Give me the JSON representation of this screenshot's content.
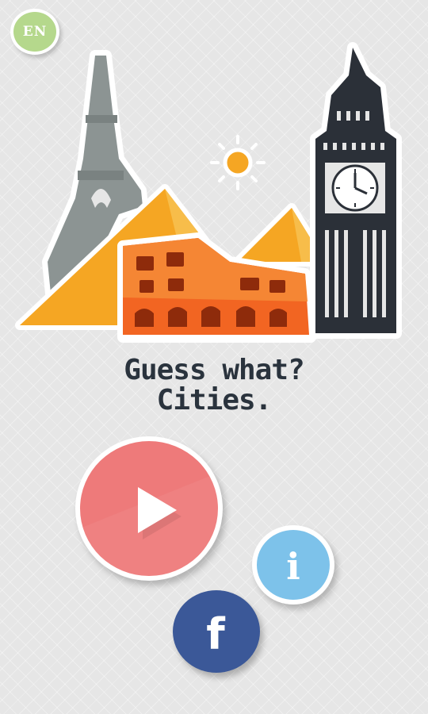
{
  "language": {
    "code": "EN"
  },
  "title": {
    "line1": "Guess what?",
    "line2": "Cities."
  },
  "buttons": {
    "play_icon": "play-icon",
    "info_label": "i",
    "facebook_label": "f"
  },
  "colors": {
    "play": "#ee7a7a",
    "info": "#7dc2ea",
    "facebook": "#3b5898",
    "language_badge": "#b5d88c",
    "title_text": "#2a333d"
  }
}
